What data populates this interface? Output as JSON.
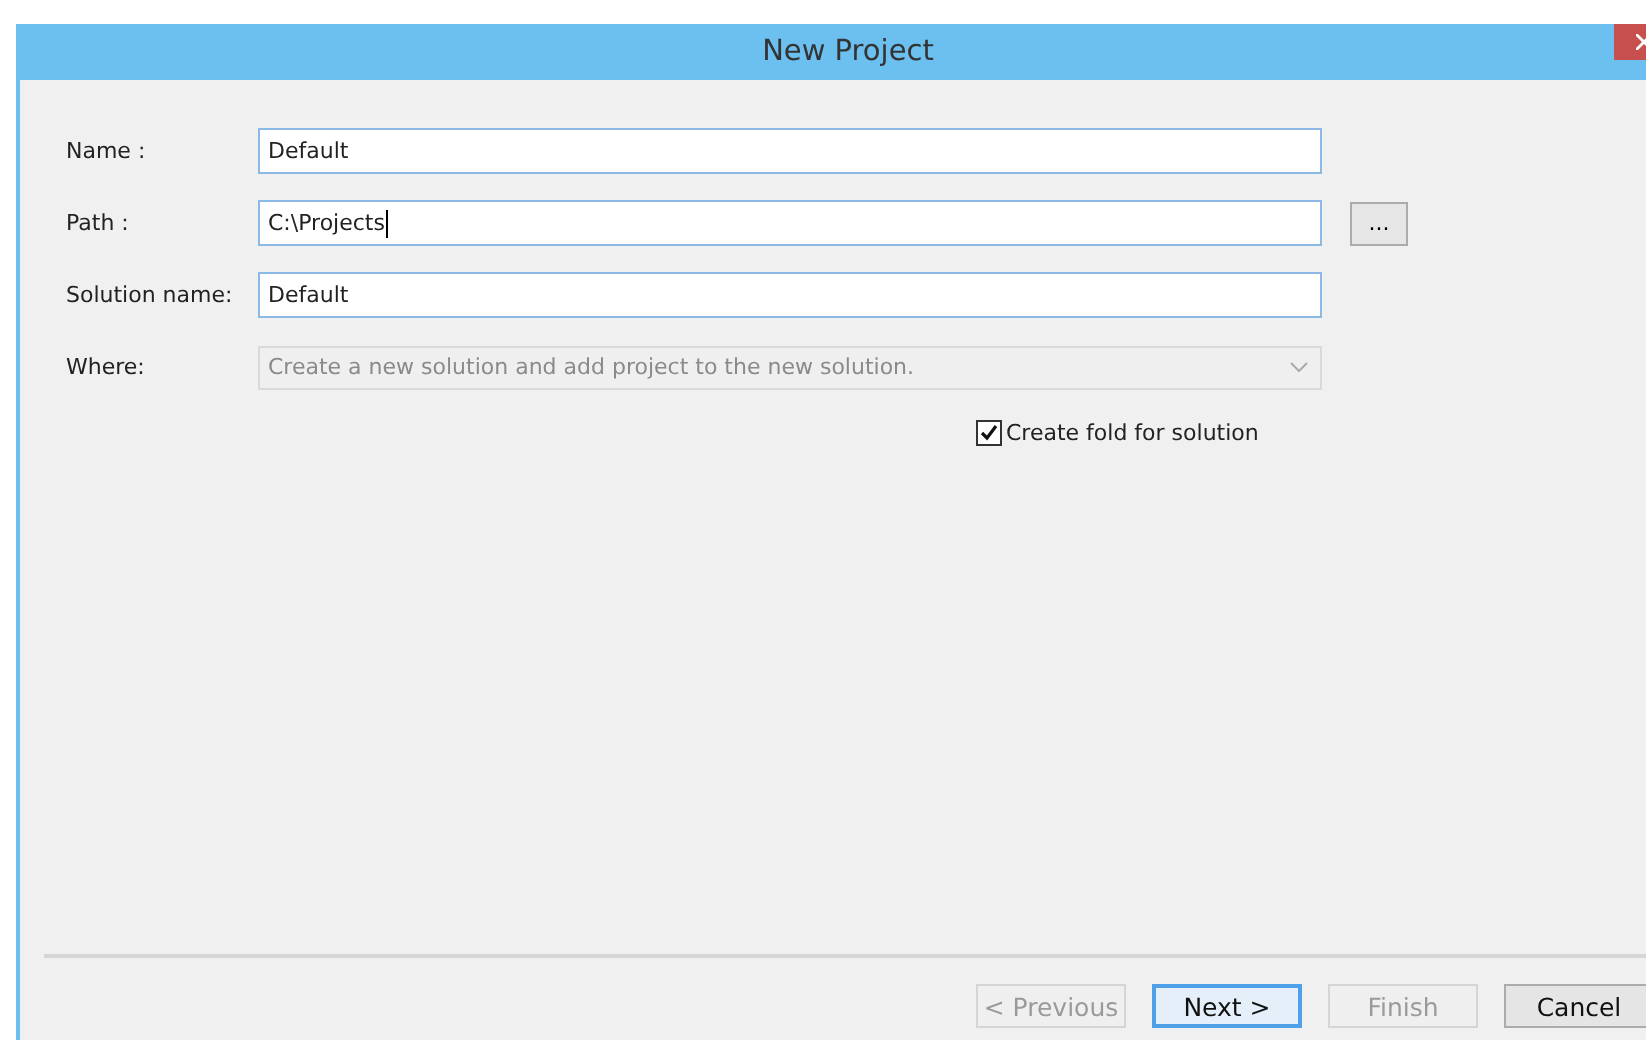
{
  "window": {
    "title": "New Project"
  },
  "fields": [
    {
      "kind": "text",
      "label": "Name :",
      "value": "Default",
      "focused": false
    },
    {
      "kind": "text",
      "label": "Path :",
      "value": "C:\\Projects",
      "focused": true,
      "browse_label": "..."
    },
    {
      "kind": "text",
      "label": "Solution name:",
      "value": "Default",
      "focused": false
    },
    {
      "kind": "dropdown",
      "label": "Where:",
      "value": "Create a new solution and add project to the new solution.",
      "disabled": true
    }
  ],
  "checkbox": {
    "label": "Create fold for solution",
    "checked": true
  },
  "buttons": [
    {
      "label": "< Previous",
      "disabled": true,
      "default": false
    },
    {
      "label": "Next >",
      "disabled": false,
      "default": true
    },
    {
      "label": "Finish",
      "disabled": true,
      "default": false
    },
    {
      "label": "Cancel",
      "disabled": false,
      "default": false
    }
  ]
}
